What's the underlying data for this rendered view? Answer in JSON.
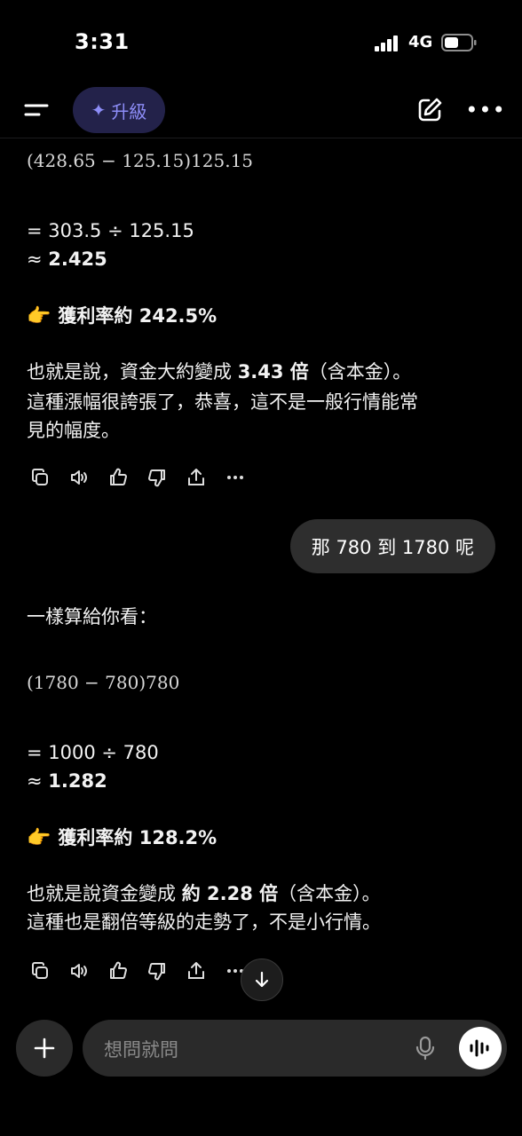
{
  "status": {
    "time": "3:31",
    "network": "4G"
  },
  "header": {
    "upgrade_label": "升級"
  },
  "assistant_1": {
    "math_fraction": "(428.65 − 125.15)125.15",
    "calc_line": "= 303.5 ÷ 125.15",
    "approx_prefix": "≈ ",
    "approx_value": "2.425",
    "pointer_emoji": "👉",
    "profit_label": "獲利率約 242.5%",
    "summary_prefix": "也就是說，資金大約變成 ",
    "summary_bold": "3.43 倍",
    "summary_suffix": "（含本金）。",
    "line2": "這種漲幅很誇張了，恭喜，這不是一般行情能常",
    "line3": "見的幅度。"
  },
  "user_message": "那 780 到 1780 呢",
  "assistant_2": {
    "intro": "一樣算給你看：",
    "math_fraction": "(1780 − 780)780",
    "calc_line": "= 1000 ÷ 780",
    "approx_prefix": "≈ ",
    "approx_value": "1.282",
    "pointer_emoji": "👉",
    "profit_label": "獲利率約 128.2%",
    "summary_prefix": "也就是說資金變成 ",
    "summary_bold": "約 2.28 倍",
    "summary_suffix": "（含本金）。",
    "line2": "這種也是翻倍等級的走勢了，不是小行情。"
  },
  "composer": {
    "placeholder": "想問就問"
  },
  "action_icons": [
    "copy-icon",
    "speaker-icon",
    "thumbs-up-icon",
    "thumbs-down-icon",
    "share-icon",
    "more-icon"
  ]
}
